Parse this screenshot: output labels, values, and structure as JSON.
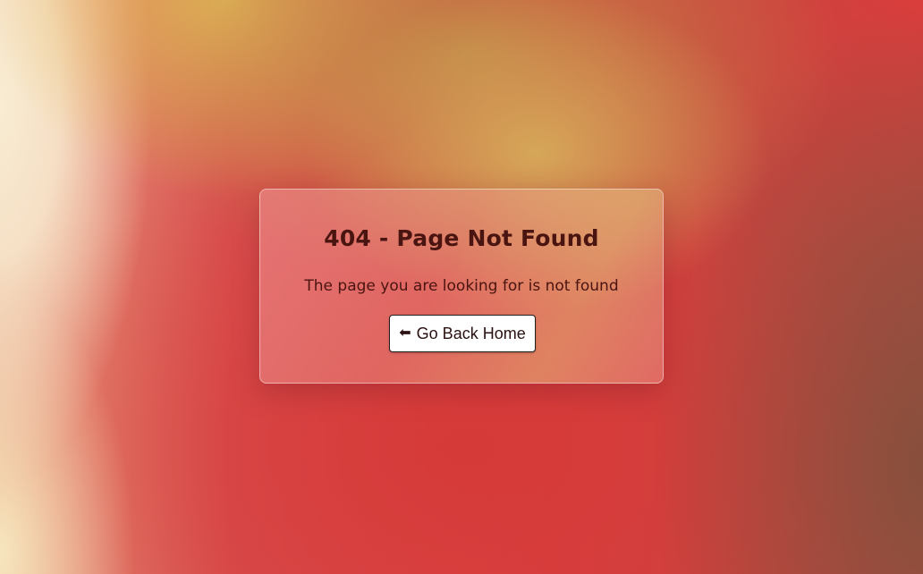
{
  "error_card": {
    "title": "404 - Page Not Found",
    "message": "The page you are looking for is not found",
    "home_button": {
      "icon": "arrow-left-icon",
      "icon_glyph": "⬅",
      "label": "Go Back Home"
    }
  },
  "colors": {
    "title_text": "#4a1410",
    "button_background": "#ffffff",
    "background_red": "#d63c3a",
    "background_gold": "#d6aa5a",
    "background_cream": "#f8ecd2"
  }
}
